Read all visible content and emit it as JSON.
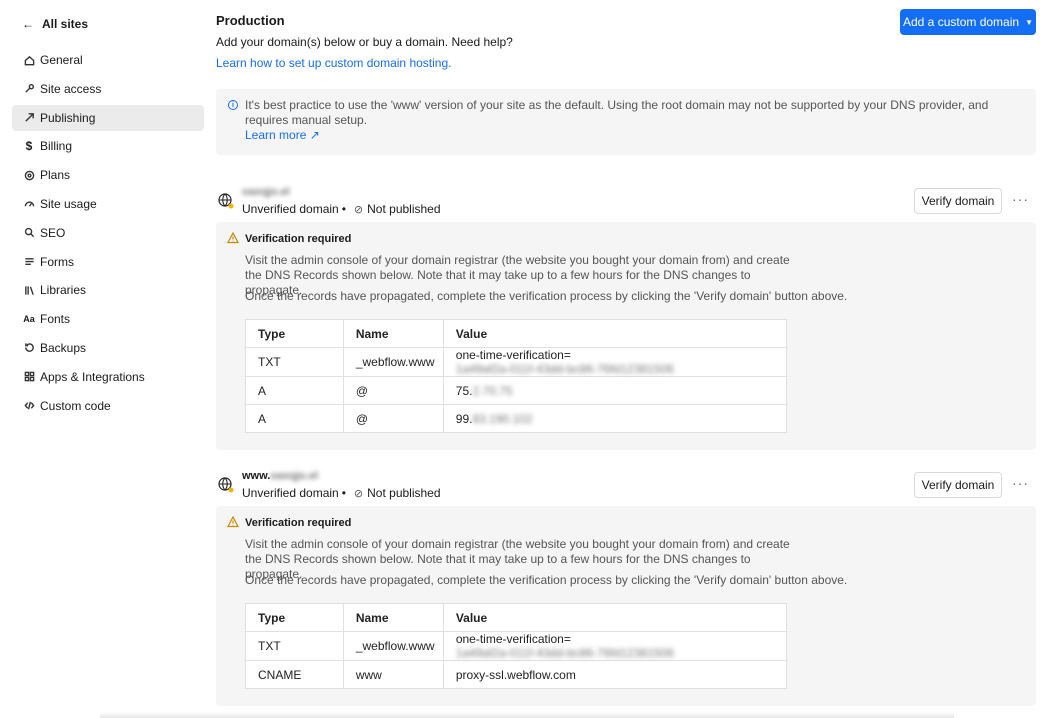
{
  "sidebar": {
    "back_label": "All sites",
    "items": [
      {
        "label": "General",
        "icon": "home-icon",
        "active": false
      },
      {
        "label": "Site access",
        "icon": "key-icon",
        "active": false
      },
      {
        "label": "Publishing",
        "icon": "publish-icon",
        "active": true
      },
      {
        "label": "Billing",
        "icon": "dollar-icon",
        "active": false
      },
      {
        "label": "Plans",
        "icon": "plans-icon",
        "active": false
      },
      {
        "label": "Site usage",
        "icon": "gauge-icon",
        "active": false
      },
      {
        "label": "SEO",
        "icon": "search-icon",
        "active": false
      },
      {
        "label": "Forms",
        "icon": "forms-icon",
        "active": false
      },
      {
        "label": "Libraries",
        "icon": "libraries-icon",
        "active": false
      },
      {
        "label": "Fonts",
        "icon": "fonts-icon",
        "active": false
      },
      {
        "label": "Backups",
        "icon": "backups-icon",
        "active": false
      },
      {
        "label": "Apps & Integrations",
        "icon": "apps-icon",
        "active": false
      },
      {
        "label": "Custom code",
        "icon": "code-icon",
        "active": false
      }
    ]
  },
  "header": {
    "title": "Production",
    "subtitle": "Add your domain(s) below or buy a domain. Need help?",
    "help_link": "Learn how to set up custom domain hosting.",
    "add_button": "Add a custom domain"
  },
  "info": {
    "text": "It's best practice to use the 'www' version of your site as the default. Using the root domain may not be supported by your DNS provider, and requires manual setup.",
    "link": "Learn more ↗"
  },
  "domains": [
    {
      "name_prefix": "",
      "name_blurred": "oaxqjo.el",
      "status": "Unverified domain",
      "dot": "•",
      "publish_status": "Not published",
      "verify_label": "Verify domain",
      "more": "···",
      "verification_title": "Verification required",
      "verification_desc": "Visit the admin console of your domain registrar (the website you bought your domain from) and create the DNS Records shown below. Note that it may take up to a few hours for the DNS changes to propagate.",
      "verification_note": "Once the records have propagated, complete the verification process by clicking the 'Verify domain' button above.",
      "table_headers": [
        "Type",
        "Name",
        "Value"
      ],
      "rows": [
        {
          "type": "TXT",
          "name": "_webflow.www",
          "value": "one-time-verification=",
          "value_blurred": "1a49af2a-011f-43dd-bc86-76fd12381506"
        },
        {
          "type": "A",
          "name": "@",
          "value": "75.",
          "value_blurred": "2.70.75"
        },
        {
          "type": "A",
          "name": "@",
          "value": "99.",
          "value_blurred": "83.190.102"
        }
      ]
    },
    {
      "name_prefix": "www.",
      "name_blurred": "oaxqjo.el",
      "status": "Unverified domain",
      "dot": "•",
      "publish_status": "Not published",
      "verify_label": "Verify domain",
      "more": "···",
      "verification_title": "Verification required",
      "verification_desc": "Visit the admin console of your domain registrar (the website you bought your domain from) and create the DNS Records shown below. Note that it may take up to a few hours for the DNS changes to propagate.",
      "verification_note": "Once the records have propagated, complete the verification process by clicking the 'Verify domain' button above.",
      "table_headers": [
        "Type",
        "Name",
        "Value"
      ],
      "rows": [
        {
          "type": "TXT",
          "name": "_webflow.www",
          "value": "one-time-verification=",
          "value_blurred": "1a49af2a-011f-43dd-bc86-76fd12381506"
        },
        {
          "type": "CNAME",
          "name": "www",
          "value": "proxy-ssl.webflow.com",
          "value_blurred": ""
        }
      ]
    }
  ],
  "colors": {
    "accent": "#146ef5",
    "panel_bg": "#f5f5f5",
    "active_nav_bg": "#ebebeb"
  }
}
